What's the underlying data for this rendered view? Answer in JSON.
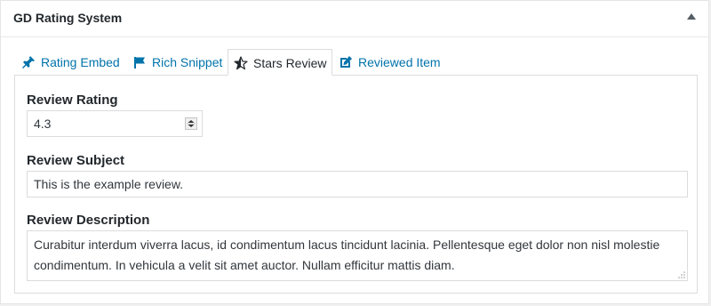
{
  "metabox": {
    "title": "GD Rating System"
  },
  "tabs": [
    {
      "label": "Rating Embed",
      "icon": "pin-icon",
      "active": false
    },
    {
      "label": "Rich Snippet",
      "icon": "flag-icon",
      "active": false
    },
    {
      "label": "Stars Review",
      "icon": "star-half-icon",
      "active": true
    },
    {
      "label": "Reviewed Item",
      "icon": "edit-icon",
      "active": false
    }
  ],
  "form": {
    "rating": {
      "label": "Review Rating",
      "value": "4.3"
    },
    "subject": {
      "label": "Review Subject",
      "value": "This is the example review."
    },
    "description": {
      "label": "Review Description",
      "value": "Curabitur interdum viverra lacus, id condimentum lacus tincidunt lacinia. Pellentesque eget dolor non nisl molestie condimentum. In vehicula a velit sit amet auctor. Nullam efficitur mattis diam."
    }
  },
  "colors": {
    "link": "#0073aa",
    "text": "#23282d",
    "border": "#dcdcde"
  }
}
